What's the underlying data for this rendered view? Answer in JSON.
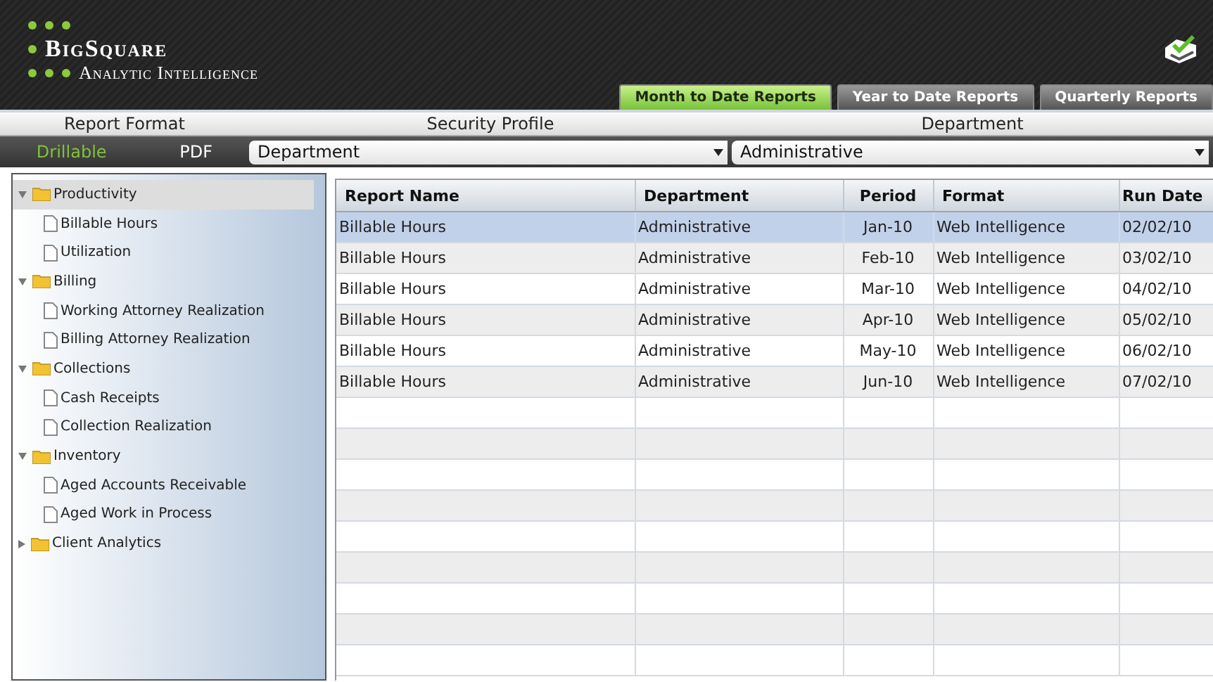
{
  "header": {
    "brand": "BigSquare",
    "tagline": "Analytic Intelligence"
  },
  "tabs": [
    {
      "label": "Month to Date Reports",
      "selected": true
    },
    {
      "label": "Year to Date Reports",
      "selected": false
    },
    {
      "label": "Quarterly Reports",
      "selected": false
    }
  ],
  "filters": {
    "labels": [
      "Report Format",
      "Security Profile",
      "Department"
    ],
    "formats": [
      {
        "label": "Drillable",
        "selected": true
      },
      {
        "label": "PDF",
        "selected": false
      }
    ],
    "security_profile": {
      "value": "Department"
    },
    "department": {
      "value": "Administrative"
    }
  },
  "tree": [
    {
      "label": "Productivity",
      "expanded": true,
      "selected": true,
      "children": [
        {
          "label": "Billable Hours",
          "selected": false
        },
        {
          "label": "Utilization",
          "selected": false
        }
      ]
    },
    {
      "label": "Billing",
      "expanded": true,
      "selected": false,
      "children": [
        {
          "label": "Working Attorney Realization",
          "selected": false
        },
        {
          "label": "Billing Attorney Realization",
          "selected": false
        }
      ]
    },
    {
      "label": "Collections",
      "expanded": true,
      "selected": false,
      "children": [
        {
          "label": "Cash Receipts",
          "selected": false
        },
        {
          "label": "Collection Realization",
          "selected": false
        }
      ]
    },
    {
      "label": "Inventory",
      "expanded": true,
      "selected": false,
      "children": [
        {
          "label": "Aged Accounts Receivable",
          "selected": false
        },
        {
          "label": "Aged Work in Process",
          "selected": false
        }
      ]
    },
    {
      "label": "Client Analytics",
      "expanded": false,
      "selected": false
    }
  ],
  "table": {
    "columns": [
      "Report Name",
      "Department",
      "Period",
      "Format",
      "Run Date"
    ],
    "rows": [
      {
        "cells": [
          "Billable Hours",
          "Administrative",
          "Jan-10",
          "Web Intelligence",
          "02/02/10"
        ],
        "selected": true
      },
      {
        "cells": [
          "Billable Hours",
          "Administrative",
          "Feb-10",
          "Web Intelligence",
          "03/02/10"
        ],
        "selected": false
      },
      {
        "cells": [
          "Billable Hours",
          "Administrative",
          "Mar-10",
          "Web Intelligence",
          "04/02/10"
        ],
        "selected": false
      },
      {
        "cells": [
          "Billable Hours",
          "Administrative",
          "Apr-10",
          "Web Intelligence",
          "05/02/10"
        ],
        "selected": false
      },
      {
        "cells": [
          "Billable Hours",
          "Administrative",
          "May-10",
          "Web Intelligence",
          "06/02/10"
        ],
        "selected": false
      },
      {
        "cells": [
          "Billable Hours",
          "Administrative",
          "Jun-10",
          "Web Intelligence",
          "07/02/10"
        ],
        "selected": false
      }
    ]
  }
}
